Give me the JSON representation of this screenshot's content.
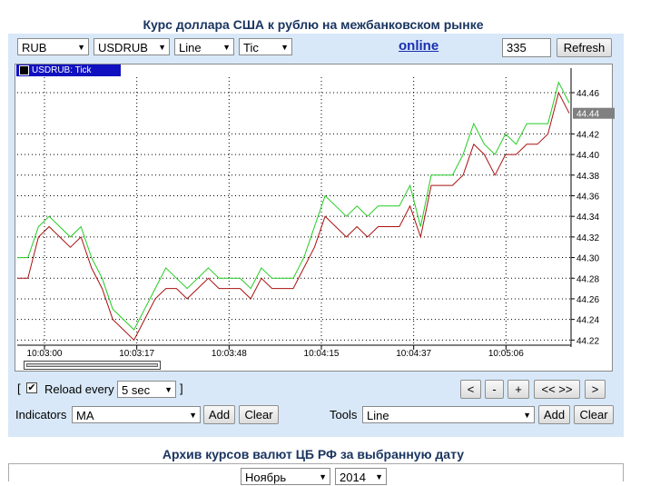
{
  "page_title": "Курс доллара США к рублю на межбанковском рынке",
  "toolbar": {
    "currency": "RUB",
    "pair": "USDRUB",
    "chart_style": "Line",
    "period": "Tic",
    "online_label": "online",
    "count_value": "335",
    "refresh_label": "Refresh"
  },
  "chart_tab_label": "USDRUB: Tick",
  "chart_data": {
    "type": "line",
    "title": "",
    "x_ticks": [
      "10:03:00",
      "10:03:17",
      "10:03:48",
      "10:04:15",
      "10:04:37",
      "10:05:06"
    ],
    "y_ticks": [
      "44.46",
      "44.42",
      "44.40",
      "44.38",
      "44.36",
      "44.34",
      "44.32",
      "44.30",
      "44.28",
      "44.26",
      "44.24",
      "44.22"
    ],
    "ylim": [
      44.215,
      44.475
    ],
    "current_value": "44.44",
    "grid": true,
    "series": [
      {
        "color": "#22cc22",
        "values": [
          44.3,
          44.3,
          44.33,
          44.34,
          44.33,
          44.32,
          44.33,
          44.3,
          44.28,
          44.25,
          44.24,
          44.23,
          44.25,
          44.27,
          44.29,
          44.28,
          44.27,
          44.28,
          44.29,
          44.28,
          44.28,
          44.28,
          44.27,
          44.29,
          44.28,
          44.28,
          44.28,
          44.3,
          44.33,
          44.36,
          44.35,
          44.34,
          44.35,
          44.34,
          44.35,
          44.35,
          44.35,
          44.37,
          44.33,
          44.38,
          44.38,
          44.38,
          44.4,
          44.43,
          44.41,
          44.4,
          44.42,
          44.41,
          44.43,
          44.43,
          44.43,
          44.47,
          44.45
        ]
      },
      {
        "color": "#aa1111",
        "values": [
          44.28,
          44.28,
          44.32,
          44.33,
          44.32,
          44.31,
          44.32,
          44.29,
          44.27,
          44.24,
          44.23,
          44.22,
          44.24,
          44.26,
          44.27,
          44.27,
          44.26,
          44.27,
          44.28,
          44.27,
          44.27,
          44.27,
          44.26,
          44.28,
          44.27,
          44.27,
          44.27,
          44.29,
          44.31,
          44.34,
          44.33,
          44.32,
          44.33,
          44.32,
          44.33,
          44.33,
          44.33,
          44.35,
          44.32,
          44.37,
          44.37,
          44.37,
          44.38,
          44.41,
          44.4,
          44.38,
          44.4,
          44.4,
          44.41,
          44.41,
          44.42,
          44.46,
          44.44
        ]
      }
    ]
  },
  "controls": {
    "reload_checked": "✔",
    "reload_label": "Reload every",
    "interval_value": "5 sec",
    "nav_prev": "<",
    "nav_minus": "-",
    "nav_plus": "+",
    "nav_both": "<< >>",
    "nav_next": ">",
    "indicators_label": "Indicators",
    "indicator_value": "MA",
    "add_label": "Add",
    "clear_label": "Clear",
    "tools_label": "Tools",
    "tool_value": "Line",
    "tools_add_label": "Add",
    "tools_clear_label": "Clear"
  },
  "archive": {
    "title": "Архив курсов валют ЦБ РФ за выбранную дату",
    "month": "Ноябрь",
    "year": "2014"
  }
}
